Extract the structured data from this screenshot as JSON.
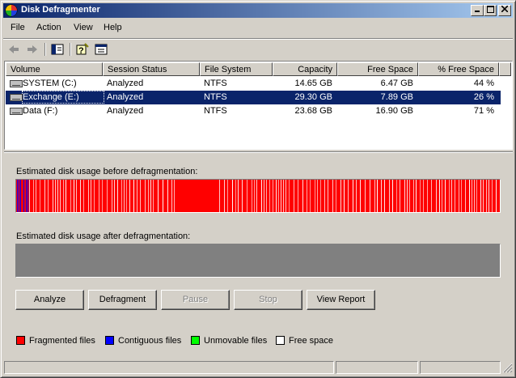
{
  "window": {
    "title": "Disk Defragmenter"
  },
  "menu": [
    "File",
    "Action",
    "View",
    "Help"
  ],
  "list": {
    "columns": [
      "Volume",
      "Session Status",
      "File System",
      "Capacity",
      "Free Space",
      "% Free Space"
    ],
    "rows": [
      {
        "volume": "SYSTEM (C:)",
        "status": "Analyzed",
        "fs": "NTFS",
        "capacity": "14.65 GB",
        "free": "6.47 GB",
        "pct": "44 %",
        "selected": false
      },
      {
        "volume": "Exchange (E:)",
        "status": "Analyzed",
        "fs": "NTFS",
        "capacity": "29.30 GB",
        "free": "7.89 GB",
        "pct": "26 %",
        "selected": true
      },
      {
        "volume": "Data (F:)",
        "status": "Analyzed",
        "fs": "NTFS",
        "capacity": "23.68 GB",
        "free": "16.90 GB",
        "pct": "71 %",
        "selected": false
      }
    ]
  },
  "labels": {
    "before": "Estimated disk usage before defragmentation:",
    "after": "Estimated disk usage after defragmentation:"
  },
  "buttons": {
    "analyze": "Analyze",
    "defragment": "Defragment",
    "pause": "Pause",
    "stop": "Stop",
    "report": "View Report"
  },
  "legend": [
    {
      "label": "Fragmented files",
      "color": "#ff0000"
    },
    {
      "label": "Contiguous files",
      "color": "#0000ff"
    },
    {
      "label": "Unmovable files",
      "color": "#00ff00"
    },
    {
      "label": "Free space",
      "color": "#ffffff"
    }
  ],
  "colors": {
    "fragmented": "#ff0000",
    "contiguous": "#0000ff",
    "free": "#ffffff",
    "selection": "#0a246a",
    "title_start": "#0a246a"
  }
}
